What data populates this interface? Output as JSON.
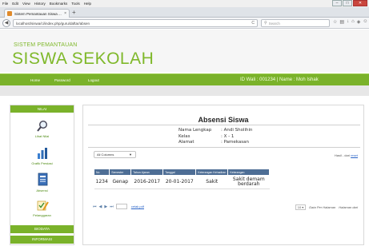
{
  "browser": {
    "menu": [
      "File",
      "Edit",
      "View",
      "History",
      "Bookmarks",
      "Tools",
      "Help"
    ],
    "tab_title": "Sistem Pemantauan Siswa ...",
    "tab_close": "×",
    "new_tab": "+",
    "url": "localhost/siswa/ci/index.php/guru/daftar/absen",
    "reload": "C",
    "search_placeholder": "Search",
    "toolbar_icons": [
      "star-icon",
      "reader-icon",
      "download-icon",
      "home-icon",
      "shield-icon",
      "smile-icon",
      "menu-icon"
    ]
  },
  "header": {
    "subtitle": "SISTEM PEMANTAUAN",
    "title": "SISWA SEKOLAH"
  },
  "nav": {
    "items": [
      "Home",
      "Password",
      "Logout"
    ],
    "user_info": "ID Wali : 001234 | Name : Moh Ishak"
  },
  "sidebar": {
    "header": "NILAI",
    "items": [
      {
        "label": "Lihat Nilai",
        "icon": "magnifier-icon"
      },
      {
        "label": "Grafik Prestasi",
        "icon": "bar-chart-icon"
      },
      {
        "label": "Absensi",
        "icon": "attendance-book-icon"
      },
      {
        "label": "Pelanggaran",
        "icon": "checklist-pencil-icon"
      }
    ],
    "buttons": [
      "BIODATA",
      "INFORMASI"
    ]
  },
  "main": {
    "title": "Absensi Siswa",
    "info": [
      {
        "key": "Nama Lengkap",
        "value": ": Andi Sholihin"
      },
      {
        "key": "Kelas",
        "value": ": X - 1"
      },
      {
        "key": "Alamat",
        "value": ": Pamekasan"
      }
    ],
    "filter_select": "All Columns",
    "hasil_label": "Hasil - dari",
    "reset_label": "reset",
    "columns": [
      "No",
      "Semester",
      "Tahun Ajaran",
      "Tanggal",
      "Keterangan Kehadiran",
      "Keterangan"
    ],
    "rows": [
      [
        "1234",
        "Genap",
        "2016-2017",
        "20-01-2017",
        "Sakit",
        "Sakit demam berdarah"
      ]
    ],
    "pager_page": "",
    "print_link": "cetak pdf",
    "per_page_value": "10",
    "per_page_label": "Data Per Halaman",
    "page_of_label": "Halaman dari"
  }
}
